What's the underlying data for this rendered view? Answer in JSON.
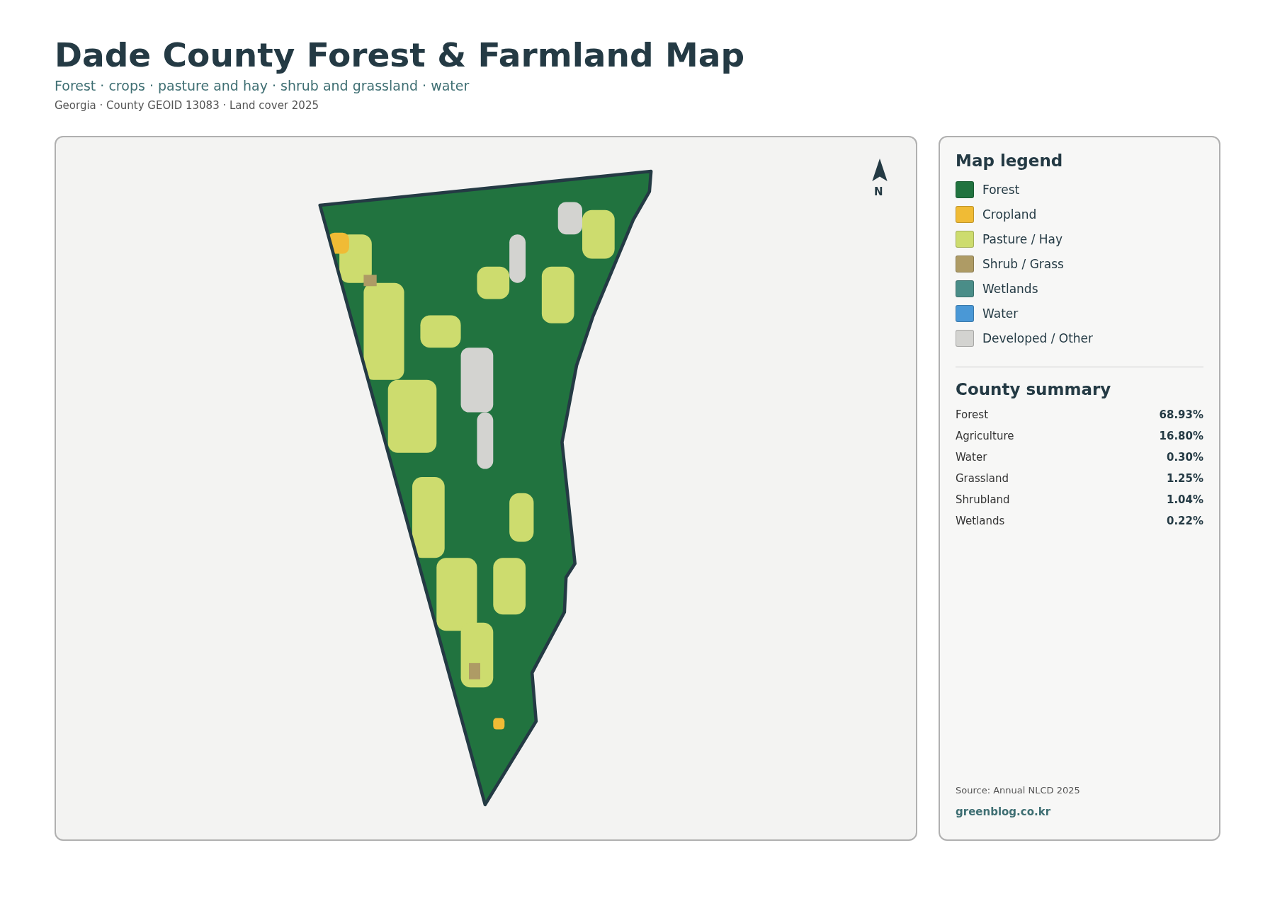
{
  "title": "Dade County Forest & Farmland Map",
  "subtitle": "Forest · crops · pasture and hay · shrub and grassland · water",
  "meta": "Georgia · County GEOID 13083 · Land cover 2025",
  "map": {
    "north_label": "N"
  },
  "legend": {
    "title": "Map legend",
    "items": [
      {
        "label": "Forest",
        "color": "#21733f"
      },
      {
        "label": "Cropland",
        "color": "#f0bb35"
      },
      {
        "label": "Pasture / Hay",
        "color": "#cddc6e"
      },
      {
        "label": "Shrub / Grass",
        "color": "#ae9b65"
      },
      {
        "label": "Wetlands",
        "color": "#4a8d88"
      },
      {
        "label": "Water",
        "color": "#4a98d6"
      },
      {
        "label": "Developed / Other",
        "color": "#d3d3d0"
      }
    ]
  },
  "summary": {
    "title": "County summary",
    "rows": [
      {
        "label": "Forest",
        "value": "68.93%"
      },
      {
        "label": "Agriculture",
        "value": "16.80%"
      },
      {
        "label": "Water",
        "value": "0.30%"
      },
      {
        "label": "Grassland",
        "value": "1.25%"
      },
      {
        "label": "Shrubland",
        "value": "1.04%"
      },
      {
        "label": "Wetlands",
        "value": "0.22%"
      }
    ]
  },
  "source": "Source: Annual NLCD 2025",
  "site": "greenblog.co.kr"
}
